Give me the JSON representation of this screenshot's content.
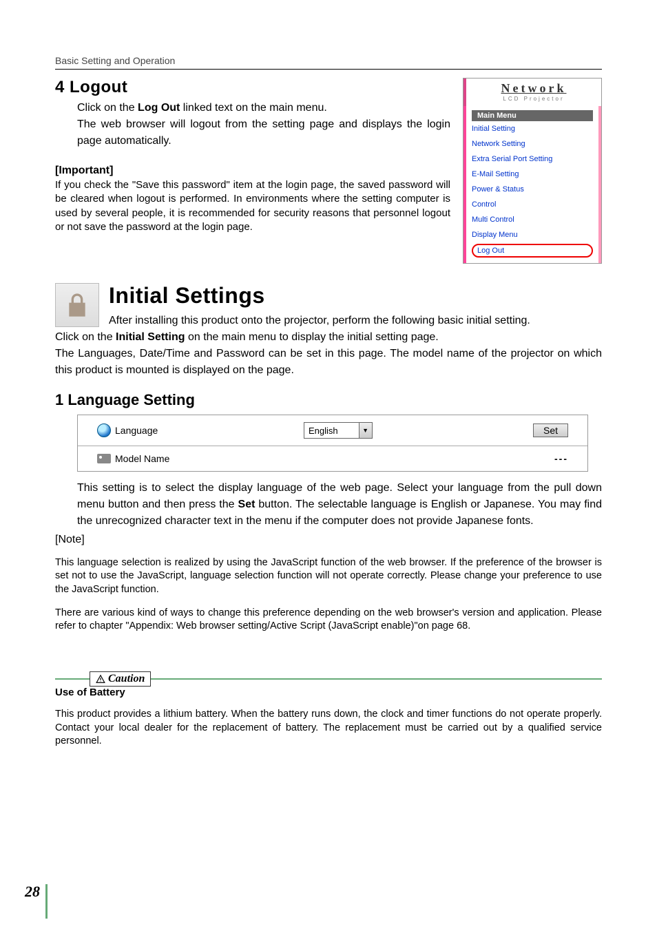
{
  "header": {
    "section_label": "Basic Setting and Operation"
  },
  "logout": {
    "title": "4 Logout",
    "p1_a": "Click on the ",
    "p1_bold": "Log Out",
    "p1_b": " linked text on the main menu.",
    "p2": "The web browser will logout from the setting page and displays the login page automatically."
  },
  "important": {
    "title": "[Important]",
    "body": "If you check the \"Save this password\" item at the login page, the saved password will be cleared when logout is performed. In environments where the setting computer is used by several people, it is recommended for security reasons that personnel logout or not save the password at the login page."
  },
  "side_menu": {
    "brand": "Network",
    "brand_sub": "LCD Projector",
    "main_label": "Main Menu",
    "items": [
      "Initial Setting",
      "Network Setting",
      "Extra Serial Port Setting",
      "E-Mail Setting",
      "Power & Status",
      "Control",
      "Multi Control",
      "Display Menu"
    ],
    "logout_item": "Log Out"
  },
  "initial": {
    "title": "Initial Settings",
    "intro": "After installing this product onto the projector, perform the following basic initial setting.",
    "p2_a": "Click on the ",
    "p2_bold": "Initial Setting",
    "p2_b": " on the main menu to display the initial setting page.",
    "p3": "The Languages, Date/Time and Password can be set in this page. The model name of the projector on which this product is mounted is displayed on the page."
  },
  "lang_section": {
    "title": "1 Language Setting",
    "row1_label": "Language",
    "row1_value": "English",
    "row1_button": "Set",
    "row2_label": "Model Name",
    "row2_value": "---",
    "desc_a": "This setting is to select the display language of the web page. Select your language from the pull down menu button and then press the ",
    "desc_bold": "Set",
    "desc_b": " button. The selectable language is English or Japanese. You may find the unrecognized character text in the menu if the computer does not provide Japanese fonts."
  },
  "note": {
    "title": "[Note]",
    "p1": "This language selection is realized by using the JavaScript function of the web browser. If the preference of the browser is set not to use the JavaScript, language selection function will not operate correctly. Please change your preference to use the JavaScript function.",
    "p2": "There are various kind of ways to change this preference depending on the web browser's version and application. Please refer to chapter \"Appendix: Web browser setting/Active Script (JavaScript enable)\"on page 68."
  },
  "caution": {
    "tag": "Caution",
    "title": "Use of Battery",
    "body": "This product provides a lithium battery. When the battery runs down, the clock and timer functions do not operate properly. Contact your local dealer for the replacement of battery. The replacement must be carried out by a qualified service personnel."
  },
  "page_number": "28"
}
